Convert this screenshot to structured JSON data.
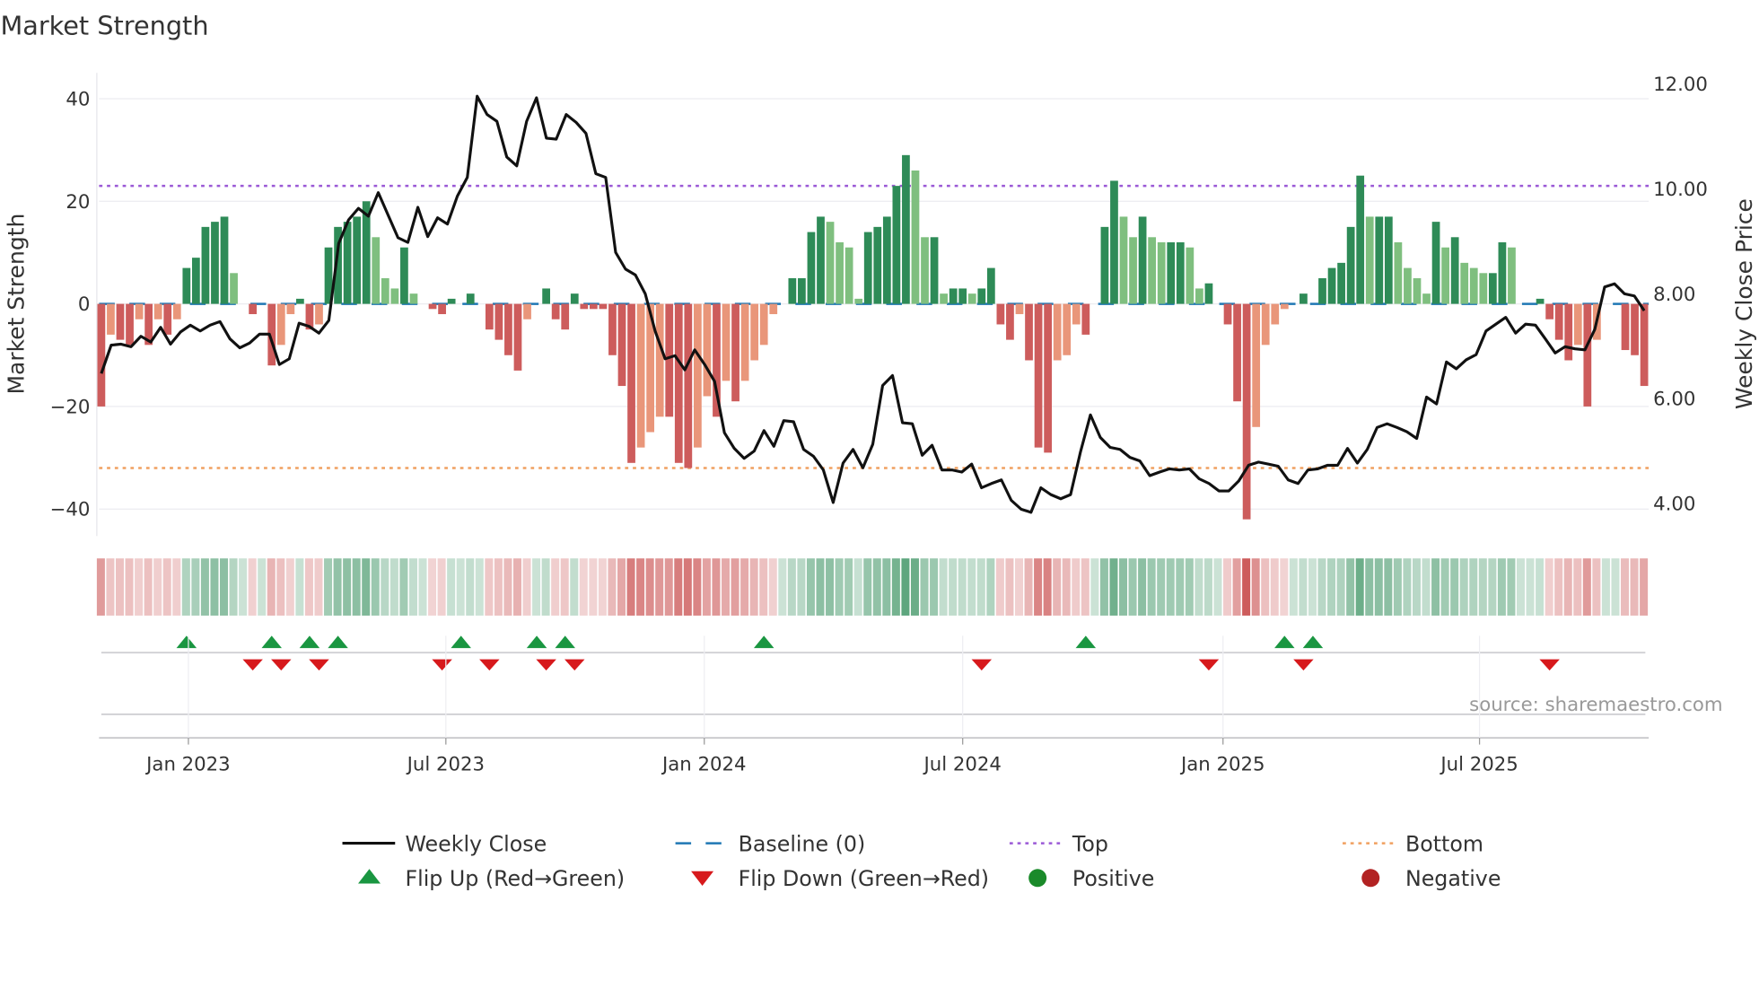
{
  "title": "Market Strength",
  "source": "source: sharemaestro.com",
  "colors": {
    "green_dark": "#2e8b57",
    "green_light": "#7fbf7f",
    "red_dark": "#cd5c5c",
    "red_light": "#e9967a",
    "top": "#9b59d6",
    "bottom": "#f0a060",
    "baseline": "#1f77b4",
    "close": "#111111",
    "flip_up": "#1a9641",
    "flip_down": "#d7191c",
    "positive": "#1a8a2a",
    "negative": "#b22222"
  },
  "chart_data": {
    "type": "bar",
    "title": "Market Strength",
    "ylabel": "Market Strength",
    "y2label": "Weekly Close Price",
    "ylim": [
      -45,
      42
    ],
    "y2lim": [
      3.45,
      12.3
    ],
    "yticks": [
      40,
      20,
      0,
      -20,
      -40
    ],
    "ytick_labels": [
      "40",
      "20",
      "0",
      "−20",
      "−40"
    ],
    "y2ticks": [
      12,
      10,
      8,
      6,
      4
    ],
    "y2tick_labels": [
      "12.00",
      "10.00",
      "8.00",
      "6.00",
      "4.00"
    ],
    "x_ticks": [
      {
        "label": "Jan 2023",
        "index": 9.2
      },
      {
        "label": "Jul 2023",
        "index": 36.4
      },
      {
        "label": "Jan 2024",
        "index": 63.7
      },
      {
        "label": "Jul 2024",
        "index": 91
      },
      {
        "label": "Jan 2025",
        "index": 118.5
      },
      {
        "label": "Jul 2025",
        "index": 145.6
      }
    ],
    "top_level": 23,
    "bottom_level": -32,
    "baseline": 0,
    "strength": [
      -20,
      -6,
      -7,
      -8,
      -3,
      -8,
      -3,
      -6,
      -3,
      7,
      9,
      15,
      16,
      17,
      6,
      0,
      -2,
      0,
      -12,
      -8,
      -2,
      1,
      -5,
      -4,
      11,
      15,
      16,
      17,
      20,
      13,
      5,
      3,
      11,
      2,
      0,
      -1,
      -2,
      1,
      0,
      2,
      0,
      -5,
      -7,
      -10,
      -13,
      -3,
      0,
      3,
      -3,
      -5,
      2,
      -1,
      -1,
      -1,
      -10,
      -16,
      -31,
      -28,
      -25,
      -22,
      -22,
      -31,
      -32,
      -28,
      -18,
      -22,
      -15,
      -19,
      -15,
      -11,
      -8,
      -2,
      0,
      5,
      5,
      14,
      17,
      16,
      12,
      11,
      1,
      14,
      15,
      17,
      23,
      29,
      26,
      13,
      13,
      2,
      3,
      3,
      2,
      3,
      7,
      -4,
      -7,
      -2,
      -11,
      -28,
      -29,
      -11,
      -10,
      -4,
      -6,
      0,
      15,
      24,
      17,
      13,
      17,
      13,
      12,
      12,
      12,
      11,
      3,
      4,
      0,
      -4,
      -19,
      -42,
      -24,
      -8,
      -4,
      -1,
      0,
      2,
      0,
      5,
      7,
      8,
      15,
      25,
      17,
      17,
      17,
      12,
      7,
      5,
      2,
      16,
      11,
      13,
      8,
      7,
      6,
      6,
      12,
      11,
      0,
      0,
      1,
      -3,
      -7,
      -11,
      -8,
      -20,
      -7,
      0,
      0,
      -9,
      -10,
      -16
    ],
    "weekly_close": [
      6.48,
      7.02,
      7.04,
      6.99,
      7.19,
      7.08,
      7.36,
      7.04,
      7.27,
      7.4,
      7.29,
      7.4,
      7.47,
      7.14,
      6.97,
      7.06,
      7.23,
      7.23,
      6.65,
      6.76,
      7.44,
      7.38,
      7.25,
      7.49,
      8.96,
      9.41,
      9.63,
      9.48,
      9.93,
      9.5,
      9.07,
      8.98,
      9.65,
      9.09,
      9.45,
      9.33,
      9.86,
      10.22,
      11.77,
      11.42,
      11.29,
      10.61,
      10.44,
      11.29,
      11.74,
      10.97,
      10.95,
      11.42,
      11.27,
      11.06,
      10.29,
      10.22,
      8.79,
      8.47,
      8.36,
      8.0,
      7.29,
      6.76,
      6.82,
      6.55,
      6.93,
      6.65,
      6.33,
      5.35,
      5.05,
      4.86,
      5.0,
      5.39,
      5.09,
      5.58,
      5.56,
      5.03,
      4.9,
      4.64,
      4.02,
      4.77,
      5.03,
      4.68,
      5.13,
      6.25,
      6.44,
      5.54,
      5.52,
      4.92,
      5.11,
      4.64,
      4.64,
      4.6,
      4.75,
      4.3,
      4.38,
      4.45,
      4.06,
      3.89,
      3.83,
      4.3,
      4.17,
      4.09,
      4.17,
      4.98,
      5.69,
      5.26,
      5.07,
      5.03,
      4.88,
      4.81,
      4.53,
      4.6,
      4.66,
      4.64,
      4.66,
      4.47,
      4.38,
      4.24,
      4.24,
      4.43,
      4.73,
      4.79,
      4.75,
      4.71,
      4.45,
      4.38,
      4.64,
      4.66,
      4.73,
      4.73,
      5.05,
      4.77,
      5.03,
      5.45,
      5.52,
      5.45,
      5.37,
      5.24,
      6.03,
      5.9,
      6.7,
      6.57,
      6.74,
      6.84,
      7.29,
      7.42,
      7.55,
      7.25,
      7.42,
      7.4,
      7.14,
      6.87,
      6.99,
      6.95,
      6.93,
      7.32,
      8.13,
      8.19,
      8.0,
      7.96,
      7.68
    ],
    "flip_up": [
      9,
      18,
      22,
      25,
      38,
      46,
      49,
      70,
      104,
      125,
      128
    ],
    "flip_down": [
      16,
      19,
      23,
      36,
      41,
      47,
      50,
      93,
      117,
      127,
      153
    ],
    "legend": [
      {
        "label": "Weekly Close",
        "kind": "line"
      },
      {
        "label": "Baseline (0)",
        "kind": "dash"
      },
      {
        "label": "Top",
        "kind": "dot-top"
      },
      {
        "label": "Bottom",
        "kind": "dot-bottom"
      },
      {
        "label": "Flip Up (Red→Green)",
        "kind": "up"
      },
      {
        "label": "Flip Down (Green→Red)",
        "kind": "down"
      },
      {
        "label": "Positive",
        "kind": "pos"
      },
      {
        "label": "Negative",
        "kind": "neg"
      }
    ],
    "legend_position": "bottom"
  }
}
